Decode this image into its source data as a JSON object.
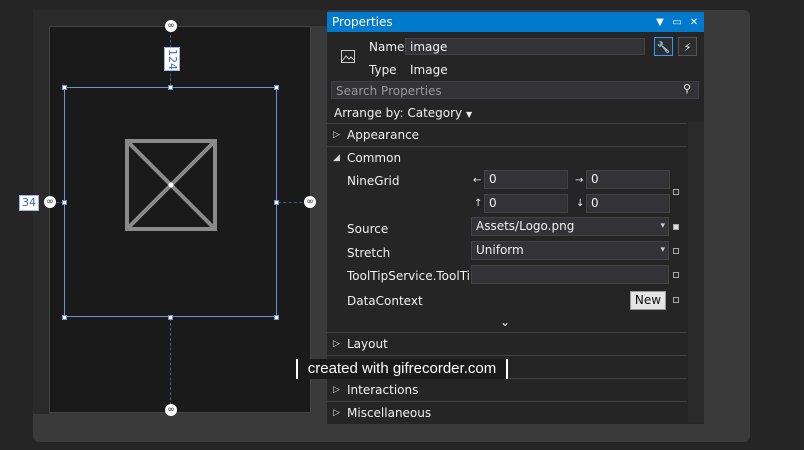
{
  "designer": {
    "top_margin": "124",
    "left_margin": "34"
  },
  "panel": {
    "title": "Properties",
    "name_label": "Name",
    "name_value": "image",
    "type_label": "Type",
    "type_value": "Image",
    "search_placeholder": "Search Properties",
    "arrange_label": "Arrange by: Category",
    "categories": {
      "appearance": "Appearance",
      "common": "Common",
      "layout": "Layout",
      "interactions": "Interactions",
      "miscellaneous": "Miscellaneous"
    },
    "properties": {
      "ninegrid_label": "NineGrid",
      "ninegrid_left": "0",
      "ninegrid_right": "0",
      "ninegrid_top": "0",
      "ninegrid_bottom": "0",
      "source_label": "Source",
      "source_value": "Assets/Logo.png",
      "stretch_label": "Stretch",
      "stretch_value": "Uniform",
      "tooltip_label": "ToolTipService.ToolTip",
      "tooltip_value": "",
      "datacontext_label": "DataContext",
      "new_button": "New"
    }
  },
  "watermark": "created with gifrecorder.com",
  "icons": [
    "dropdown-icon",
    "pin-icon",
    "close-icon",
    "wrench-icon",
    "lightning-icon",
    "search-icon",
    "expand-icon",
    "collapse-icon",
    "chevron-down-icon",
    "image-icon",
    "link-icon"
  ],
  "colors": {
    "accent": "#007acc",
    "selection": "#6f8fd6"
  }
}
